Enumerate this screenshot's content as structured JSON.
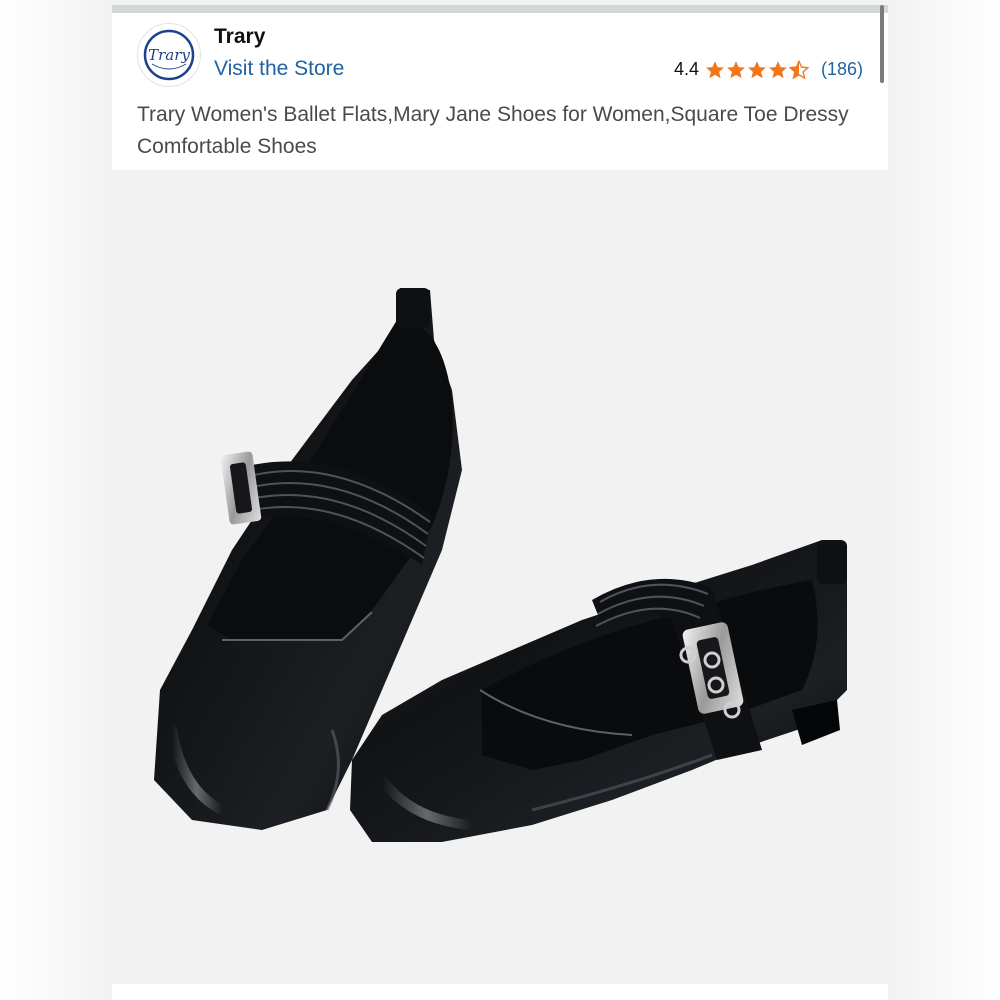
{
  "store": {
    "name": "Trary",
    "link_label": "Visit the Store",
    "logo_text": "Trary"
  },
  "rating": {
    "value": "4.4",
    "stars": 4.4,
    "review_count": "(186)",
    "star_color": "#f3761b"
  },
  "product": {
    "title": "Trary Women's Ballet Flats,Mary Jane Shoes for Women,Square Toe Dressy Comfortable Shoes",
    "image_description_icon": "black-mary-jane-flats-image"
  },
  "colors": {
    "link": "#2162a1",
    "text": "#0f1111",
    "title_text": "#4a4a4a",
    "image_background": "#f2f2f2"
  }
}
